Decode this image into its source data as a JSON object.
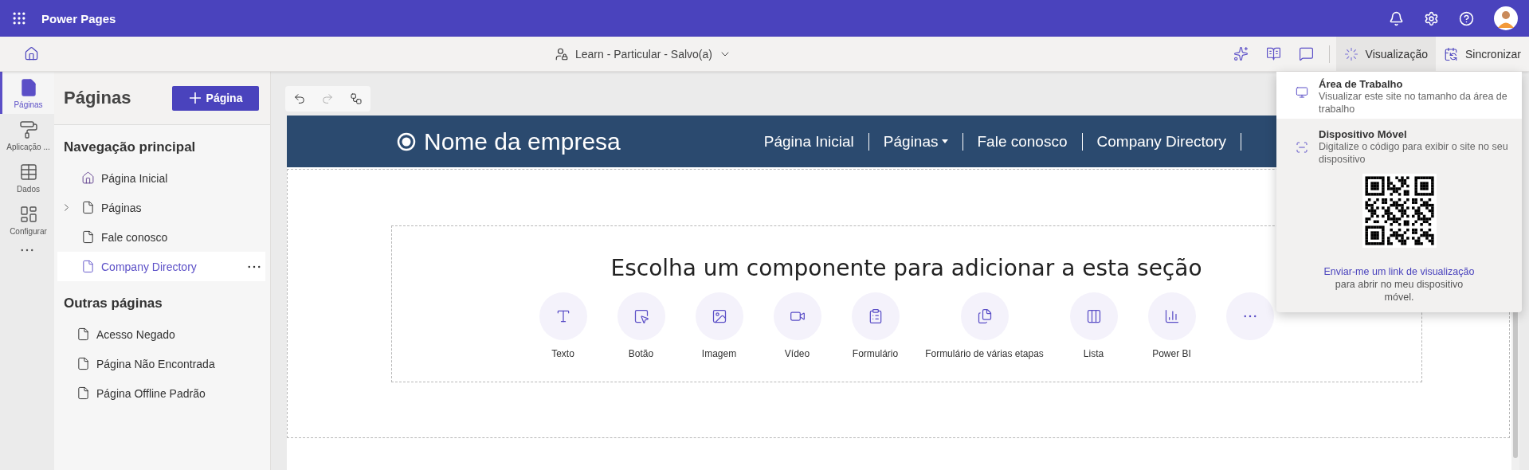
{
  "app": {
    "title": "Power Pages"
  },
  "command_bar": {
    "site_status": "Learn - Particular - Salvo(a)",
    "preview_button": {
      "label": "Visualização",
      "expanded": true
    },
    "sync_button": "Sincronizar"
  },
  "left_rail": [
    {
      "label": "Páginas",
      "kind": "pages",
      "selected": true
    },
    {
      "label": "Aplicação ...",
      "kind": "styling",
      "selected": false
    },
    {
      "label": "Dados",
      "kind": "data",
      "selected": false
    },
    {
      "label": "Configurar",
      "kind": "setup",
      "selected": false
    }
  ],
  "pages_panel": {
    "title": "Páginas",
    "add_button": "Página",
    "sections": [
      {
        "heading": "Navegação principal",
        "items": [
          {
            "label": "Página Inicial",
            "kind": "home",
            "selected": false
          },
          {
            "label": "Páginas",
            "kind": "page",
            "expanded": false,
            "selected": false
          },
          {
            "label": "Fale conosco",
            "kind": "page",
            "selected": false
          },
          {
            "label": "Company Directory",
            "kind": "page",
            "selected": true
          }
        ]
      },
      {
        "heading": "Outras páginas",
        "items": [
          {
            "label": "Acesso Negado",
            "kind": "page",
            "selected": false
          },
          {
            "label": "Página Não Encontrada",
            "kind": "page",
            "selected": false
          },
          {
            "label": "Página Offline Padrão",
            "kind": "page",
            "selected": false
          }
        ]
      }
    ]
  },
  "site": {
    "brand": "Nome da empresa",
    "nav": [
      {
        "label": "Página Inicial",
        "has_menu": false
      },
      {
        "label": "Páginas",
        "has_menu": true
      },
      {
        "label": "Fale conosco",
        "has_menu": false
      },
      {
        "label": "Company Directory",
        "has_menu": false
      }
    ],
    "section_prompt": "Escolha um componente para adicionar a esta seção",
    "components": [
      {
        "label": "Texto",
        "kind": "text"
      },
      {
        "label": "Botão",
        "kind": "button"
      },
      {
        "label": "Imagem",
        "kind": "image"
      },
      {
        "label": "Vídeo",
        "kind": "video"
      },
      {
        "label": "Formulário",
        "kind": "form"
      },
      {
        "label": "Formulário de várias etapas",
        "kind": "multistep"
      },
      {
        "label": "Lista",
        "kind": "list"
      },
      {
        "label": "Power BI",
        "kind": "powerbi"
      },
      {
        "kind": "more"
      }
    ]
  },
  "preview_menu": {
    "items": [
      {
        "title": "Área de Trabalho",
        "description": "Visualizar este site no tamanho da área de trabalho",
        "kind": "desktop",
        "selected": false
      },
      {
        "title": "Dispositivo Móvel",
        "description": "Digitalize o código para exibir o site no seu dispositivo",
        "kind": "mobile",
        "selected": true
      }
    ],
    "link": "Enviar-me um link de visualização",
    "link_note": "para abrir no meu dispositivo móvel."
  }
}
